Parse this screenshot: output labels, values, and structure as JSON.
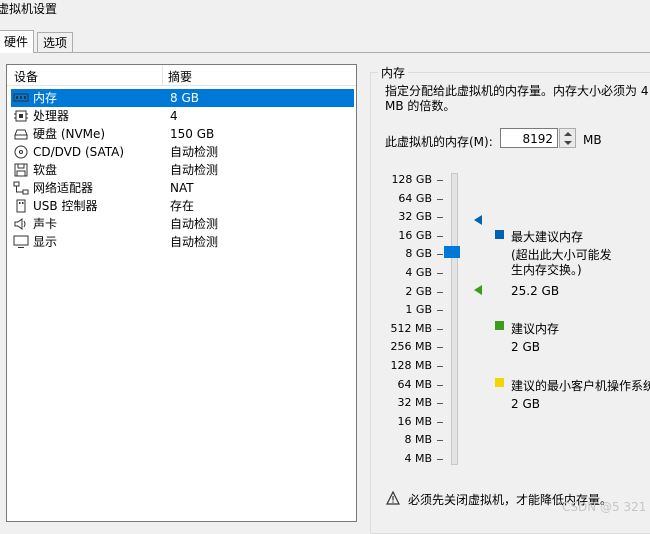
{
  "window": {
    "title": "虚拟机设置"
  },
  "tabs": [
    {
      "label": "硬件"
    },
    {
      "label": "选项"
    }
  ],
  "device_list": {
    "headers": {
      "device": "设备",
      "summary": "摘要"
    },
    "rows": [
      {
        "name": "内存",
        "summary": "8 GB",
        "icon": "memory-icon",
        "selected": true
      },
      {
        "name": "处理器",
        "summary": "4",
        "icon": "cpu-icon"
      },
      {
        "name": "硬盘 (NVMe)",
        "summary": "150 GB",
        "icon": "harddisk-icon"
      },
      {
        "name": "CD/DVD (SATA)",
        "summary": "自动检测",
        "icon": "cd-icon"
      },
      {
        "name": "软盘",
        "summary": "自动检测",
        "icon": "floppy-icon"
      },
      {
        "name": "网络适配器",
        "summary": "NAT",
        "icon": "network-icon"
      },
      {
        "name": "USB 控制器",
        "summary": "存在",
        "icon": "usb-icon"
      },
      {
        "name": "声卡",
        "summary": "自动检测",
        "icon": "speaker-icon"
      },
      {
        "name": "显示",
        "summary": "自动检测",
        "icon": "monitor-icon"
      }
    ]
  },
  "memory": {
    "group_title": "内存",
    "description": "指定分配给此虚拟机的内存量。内存大小必须为 4 MB 的倍数。",
    "field_label": "此虚拟机的内存(M):",
    "value": "8192",
    "unit": "MB",
    "scale_labels": [
      "128 GB",
      "64 GB",
      "32 GB",
      "16 GB",
      "8 GB",
      "4 GB",
      "2 GB",
      "1 GB",
      "512 MB",
      "256 MB",
      "128 MB",
      "64 MB",
      "32 MB",
      "16 MB",
      "8 MB",
      "4 MB"
    ],
    "legend": {
      "max_recommended": {
        "label": "最大建议内存",
        "note": "(超出此大小可能发生内存交换。)",
        "value": "25.2 GB",
        "color": "#0063b1"
      },
      "recommended": {
        "label": "建议内存",
        "value": "2 GB",
        "color": "#3c9d1a"
      },
      "min_guest": {
        "label": "建议的最小客户机操作系统",
        "value": "2 GB",
        "color": "#f2d600"
      }
    },
    "warning": "必须先关闭虚拟机，才能降低内存量。"
  },
  "watermark": "CSDN @5 321"
}
